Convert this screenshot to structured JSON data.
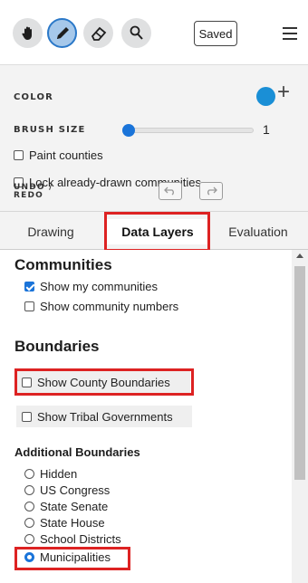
{
  "toolbar": {
    "tools": [
      {
        "name": "pan",
        "icon": "hand-icon"
      },
      {
        "name": "brush",
        "icon": "pencil-icon",
        "active": true
      },
      {
        "name": "eraser",
        "icon": "eraser-icon"
      },
      {
        "name": "search",
        "icon": "search-icon"
      }
    ],
    "saved_label": "Saved",
    "menu_icon": "hamburger-menu-icon"
  },
  "settings": {
    "color_label": "COLOR",
    "color_value": "#1a8fd6",
    "add_icon": "+",
    "brush_size_label": "BRUSH SIZE",
    "brush_size_value": "1",
    "paint_counties_label": "Paint counties",
    "lock_label": "Lock already-drawn communities",
    "undo_label": "UNDO /",
    "redo_label": "REDO"
  },
  "tabs": [
    {
      "label": "Drawing"
    },
    {
      "label": "Data Layers",
      "active": true
    },
    {
      "label": "Evaluation"
    }
  ],
  "layers": {
    "communities_title": "Communities",
    "show_my_communities": "Show my communities",
    "show_community_numbers": "Show community numbers",
    "boundaries_title": "Boundaries",
    "show_county_boundaries": "Show County Boundaries",
    "show_tribal_governments": "Show Tribal Governments",
    "additional_title": "Additional Boundaries",
    "options": [
      "Hidden",
      "US Congress",
      "State Senate",
      "State House",
      "School Districts",
      "Municipalities"
    ],
    "selected_option": "Municipalities"
  },
  "colors": {
    "accent": "#1a74d9",
    "highlight": "#dd2222",
    "active_tool_bg": "#a6c8ea"
  }
}
